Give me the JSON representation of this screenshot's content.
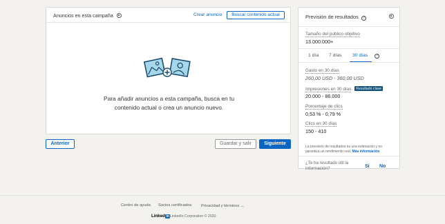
{
  "ads_panel": {
    "title": "Anuncios en esta campaña",
    "create_link": "Crear anuncio",
    "search_button": "Buscar contenido actual",
    "empty_message": "Para añadir anuncios a esta campaña, busca en tu contenido actual o crea un anuncio nuevo."
  },
  "nav": {
    "prev_button": "Anterior",
    "save_exit_button": "Guardar y salir",
    "next_button": "Siguiente"
  },
  "forecast": {
    "title": "Previsión de resultados",
    "audience_label": "Tamaño del público objetivo",
    "audience_value": "13.000.000+",
    "tabs": [
      {
        "label": "1 día",
        "active": false
      },
      {
        "label": "7 días",
        "active": false
      },
      {
        "label": "30 días",
        "active": true
      }
    ],
    "spend_label": "Gasto en 30 días",
    "spend_value": "260,00 USD - 360,00 USD",
    "impressions_label": "Impresiones en 30 días",
    "impressions_badge": "Resultado clave",
    "impressions_value": "20.000 - 86.000",
    "ctr_label": "Porcentaje de clics",
    "ctr_value": "0,53 % - 0,79 %",
    "clicks_label": "Clics en 30 días",
    "clicks_value": "150 - 410",
    "disclaimer": "La previsión de resultados es una estimación y no garantiza un rendimiento real.",
    "more_info": "Más información",
    "feedback_question": "¿Te ha resultado útil la información?",
    "yes": "Sí",
    "no": "No"
  },
  "footer": {
    "help": "Centro de ayuda",
    "partners": "Socios certificados",
    "privacy": "Privacidad y términos",
    "logo_text": "Linked",
    "logo_in": "in",
    "copyright": "LinkedIn Corporation © 2020"
  },
  "colors": {
    "accent": "#0a66c2",
    "badge": "#0e4f7a",
    "background": "#f3f2ef"
  }
}
